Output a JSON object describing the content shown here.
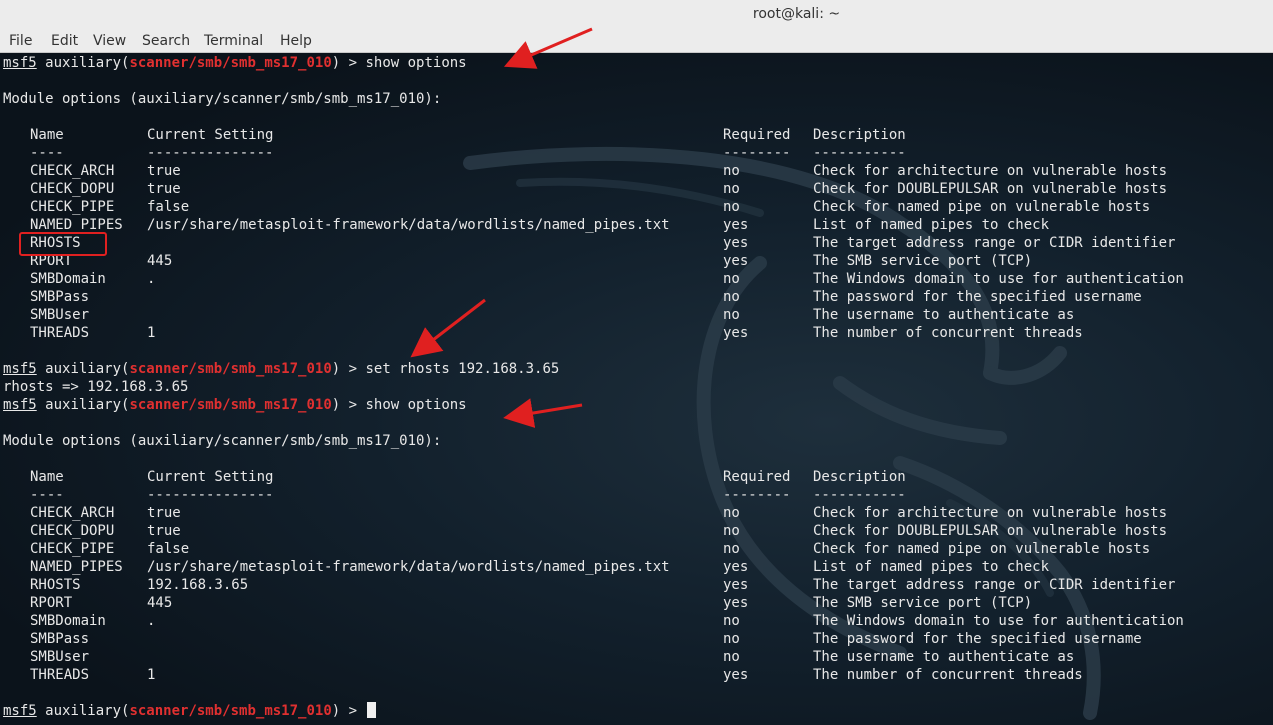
{
  "window": {
    "title": "root@kali: ~"
  },
  "menu": [
    "File",
    "Edit",
    "View",
    "Search",
    "Terminal",
    "Help"
  ],
  "prompt": {
    "msf": "msf5",
    "pre": "auxiliary(",
    "module": "scanner/smb/smb_ms17_010",
    "post": ") > "
  },
  "commands": {
    "show": "show options",
    "set": "set rhosts 192.168.3.65"
  },
  "set_result": "rhosts => 192.168.3.65",
  "module_header": "Module options (auxiliary/scanner/smb/smb_ms17_010):",
  "table": {
    "headers": {
      "name": "Name",
      "setting": "Current Setting",
      "required": "Required",
      "description": "Description"
    },
    "dashes": {
      "name": "----",
      "setting": "---------------",
      "required": "--------",
      "description": "-----------"
    },
    "before": [
      {
        "name": "CHECK_ARCH",
        "setting": "true",
        "required": "no",
        "description": "Check for architecture on vulnerable hosts"
      },
      {
        "name": "CHECK_DOPU",
        "setting": "true",
        "required": "no",
        "description": "Check for DOUBLEPULSAR on vulnerable hosts"
      },
      {
        "name": "CHECK_PIPE",
        "setting": "false",
        "required": "no",
        "description": "Check for named pipe on vulnerable hosts"
      },
      {
        "name": "NAMED_PIPES",
        "setting": "/usr/share/metasploit-framework/data/wordlists/named_pipes.txt",
        "required": "yes",
        "description": "List of named pipes to check"
      },
      {
        "name": "RHOSTS",
        "setting": "",
        "required": "yes",
        "description": "The target address range or CIDR identifier"
      },
      {
        "name": "RPORT",
        "setting": "445",
        "required": "yes",
        "description": "The SMB service port (TCP)"
      },
      {
        "name": "SMBDomain",
        "setting": ".",
        "required": "no",
        "description": "The Windows domain to use for authentication"
      },
      {
        "name": "SMBPass",
        "setting": "",
        "required": "no",
        "description": "The password for the specified username"
      },
      {
        "name": "SMBUser",
        "setting": "",
        "required": "no",
        "description": "The username to authenticate as"
      },
      {
        "name": "THREADS",
        "setting": "1",
        "required": "yes",
        "description": "The number of concurrent threads"
      }
    ],
    "after": [
      {
        "name": "CHECK_ARCH",
        "setting": "true",
        "required": "no",
        "description": "Check for architecture on vulnerable hosts"
      },
      {
        "name": "CHECK_DOPU",
        "setting": "true",
        "required": "no",
        "description": "Check for DOUBLEPULSAR on vulnerable hosts"
      },
      {
        "name": "CHECK_PIPE",
        "setting": "false",
        "required": "no",
        "description": "Check for named pipe on vulnerable hosts"
      },
      {
        "name": "NAMED_PIPES",
        "setting": "/usr/share/metasploit-framework/data/wordlists/named_pipes.txt",
        "required": "yes",
        "description": "List of named pipes to check"
      },
      {
        "name": "RHOSTS",
        "setting": "192.168.3.65",
        "required": "yes",
        "description": "The target address range or CIDR identifier"
      },
      {
        "name": "RPORT",
        "setting": "445",
        "required": "yes",
        "description": "The SMB service port (TCP)"
      },
      {
        "name": "SMBDomain",
        "setting": ".",
        "required": "no",
        "description": "The Windows domain to use for authentication"
      },
      {
        "name": "SMBPass",
        "setting": "",
        "required": "no",
        "description": "The password for the specified username"
      },
      {
        "name": "SMBUser",
        "setting": "",
        "required": "no",
        "description": "The username to authenticate as"
      },
      {
        "name": "THREADS",
        "setting": "1",
        "required": "yes",
        "description": "The number of concurrent threads"
      }
    ]
  },
  "colors": {
    "module_red": "#e03030",
    "annotation_red": "#e02020",
    "text": "#e8e8e8"
  },
  "icons": {
    "cursor": "block-cursor-icon",
    "arrow": "annotation-arrow-icon",
    "background": "kali-dragon-icon"
  }
}
